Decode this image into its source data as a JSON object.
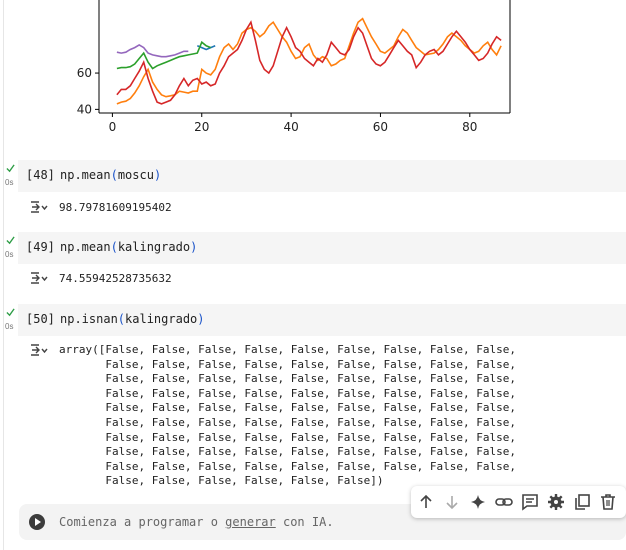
{
  "chart_data": {
    "type": "line",
    "x_ticks": [
      "0",
      "20",
      "40",
      "60",
      "80"
    ],
    "y_ticks": [
      "40",
      "60"
    ],
    "xlim": [
      -3,
      89
    ],
    "ylim": [
      38,
      103
    ],
    "colors": {
      "blue": "#1f77b4",
      "orange": "#ff7f0e",
      "green": "#2ca02c",
      "red": "#d62728",
      "purple": "#9467bd"
    },
    "series": [
      {
        "color": "purple",
        "values": [
          [
            1,
            71.5
          ],
          [
            2,
            71
          ],
          [
            3,
            71.5
          ],
          [
            4,
            73
          ],
          [
            5,
            74
          ],
          [
            6,
            75.5
          ],
          [
            7,
            74
          ],
          [
            8,
            71
          ],
          [
            9,
            70
          ],
          [
            10,
            69.5
          ],
          [
            11,
            69
          ],
          [
            12,
            69
          ],
          [
            13,
            69.5
          ],
          [
            14,
            70
          ],
          [
            15,
            71
          ],
          [
            16,
            72
          ],
          [
            17,
            72
          ]
        ]
      },
      {
        "color": "blue",
        "values": [
          [
            19,
            75
          ],
          [
            20,
            74
          ],
          [
            21,
            73
          ],
          [
            22,
            74
          ],
          [
            23,
            75
          ]
        ]
      },
      {
        "color": "green",
        "values": [
          [
            1,
            62.5
          ],
          [
            2,
            63
          ],
          [
            3,
            63
          ],
          [
            4,
            63.5
          ],
          [
            5,
            65
          ],
          [
            6,
            68
          ],
          [
            7,
            71
          ],
          [
            8,
            66
          ],
          [
            9,
            62.5
          ],
          [
            10,
            64
          ],
          [
            11,
            65
          ],
          [
            12,
            66
          ],
          [
            13,
            67
          ],
          [
            14,
            68
          ],
          [
            15,
            69
          ],
          [
            16,
            69.5
          ],
          [
            17,
            70
          ],
          [
            18,
            70.5
          ],
          [
            19,
            71
          ],
          [
            20,
            77
          ],
          [
            21,
            75
          ],
          [
            22,
            74
          ]
        ]
      },
      {
        "color": "orange",
        "values": [
          [
            1,
            43
          ],
          [
            2,
            44
          ],
          [
            3,
            44.5
          ],
          [
            4,
            46
          ],
          [
            5,
            49
          ],
          [
            6,
            53
          ],
          [
            7,
            58
          ],
          [
            8,
            62
          ],
          [
            9,
            55
          ],
          [
            10,
            51
          ],
          [
            11,
            48
          ],
          [
            12,
            47
          ],
          [
            13,
            47.5
          ],
          [
            14,
            48
          ],
          [
            15,
            50
          ],
          [
            16,
            49.5
          ],
          [
            17,
            49
          ],
          [
            18,
            50
          ],
          [
            19,
            50
          ],
          [
            20,
            62
          ],
          [
            21,
            60
          ],
          [
            22,
            59
          ],
          [
            23,
            62
          ],
          [
            24,
            69
          ],
          [
            25,
            74
          ],
          [
            26,
            76
          ],
          [
            27,
            73
          ],
          [
            28,
            76
          ],
          [
            29,
            82
          ],
          [
            30,
            84
          ],
          [
            31,
            85
          ],
          [
            32,
            83
          ],
          [
            33,
            80
          ],
          [
            34,
            82
          ],
          [
            35,
            86
          ],
          [
            36,
            88
          ],
          [
            37,
            84
          ],
          [
            38,
            80
          ],
          [
            39,
            77
          ],
          [
            40,
            72
          ],
          [
            41,
            68
          ],
          [
            42,
            69
          ],
          [
            43,
            74
          ],
          [
            44,
            76
          ],
          [
            45,
            70
          ],
          [
            46,
            67
          ],
          [
            47,
            69
          ],
          [
            48,
            68
          ],
          [
            49,
            64
          ],
          [
            50,
            65
          ],
          [
            51,
            67
          ],
          [
            52,
            68
          ],
          [
            53,
            75
          ],
          [
            54,
            82
          ],
          [
            55,
            88
          ],
          [
            56,
            90
          ],
          [
            57,
            85
          ],
          [
            58,
            80
          ],
          [
            59,
            76
          ],
          [
            60,
            72
          ],
          [
            61,
            71
          ],
          [
            62,
            73
          ],
          [
            63,
            75
          ],
          [
            64,
            80
          ],
          [
            65,
            84
          ],
          [
            66,
            82
          ],
          [
            67,
            78
          ],
          [
            68,
            74
          ],
          [
            69,
            72
          ],
          [
            70,
            70
          ],
          [
            71,
            70.5
          ],
          [
            72,
            71
          ],
          [
            73,
            73
          ],
          [
            74,
            76
          ],
          [
            75,
            80
          ],
          [
            76,
            82
          ],
          [
            77,
            80
          ],
          [
            78,
            78
          ],
          [
            79,
            75
          ],
          [
            80,
            73
          ],
          [
            81,
            71
          ],
          [
            82,
            72
          ],
          [
            83,
            75
          ],
          [
            84,
            77
          ],
          [
            85,
            73
          ],
          [
            86,
            70
          ],
          [
            87,
            75
          ]
        ]
      },
      {
        "color": "red",
        "values": [
          [
            1,
            48
          ],
          [
            2,
            51
          ],
          [
            3,
            51
          ],
          [
            4,
            53
          ],
          [
            5,
            57
          ],
          [
            6,
            61
          ],
          [
            7,
            66
          ],
          [
            8,
            57
          ],
          [
            9,
            50
          ],
          [
            10,
            44
          ],
          [
            11,
            43
          ],
          [
            12,
            44
          ],
          [
            13,
            45
          ],
          [
            14,
            48
          ],
          [
            15,
            53
          ],
          [
            16,
            57
          ],
          [
            17,
            53
          ],
          [
            18,
            56
          ],
          [
            19,
            57
          ],
          [
            20,
            54
          ],
          [
            21,
            55
          ],
          [
            22,
            53
          ],
          [
            23,
            54
          ],
          [
            24,
            60
          ],
          [
            25,
            64
          ],
          [
            26,
            69
          ],
          [
            27,
            71
          ],
          [
            28,
            73
          ],
          [
            29,
            78
          ],
          [
            30,
            84
          ],
          [
            31,
            88
          ],
          [
            32,
            78
          ],
          [
            33,
            67
          ],
          [
            34,
            62
          ],
          [
            35,
            60
          ],
          [
            36,
            64
          ],
          [
            37,
            72
          ],
          [
            38,
            80
          ],
          [
            39,
            85
          ],
          [
            40,
            80
          ],
          [
            41,
            74
          ],
          [
            42,
            72
          ],
          [
            43,
            68
          ],
          [
            44,
            66
          ],
          [
            45,
            64
          ],
          [
            46,
            68
          ],
          [
            47,
            66
          ],
          [
            48,
            70
          ],
          [
            49,
            77
          ],
          [
            50,
            74
          ],
          [
            51,
            71
          ],
          [
            52,
            70
          ],
          [
            53,
            73
          ],
          [
            54,
            80
          ],
          [
            55,
            85
          ],
          [
            56,
            82
          ],
          [
            57,
            75
          ],
          [
            58,
            68
          ],
          [
            59,
            65
          ],
          [
            60,
            64
          ],
          [
            61,
            66
          ],
          [
            62,
            70
          ],
          [
            63,
            74
          ],
          [
            64,
            78
          ],
          [
            65,
            75
          ],
          [
            66,
            72
          ],
          [
            67,
            70
          ],
          [
            68,
            63
          ],
          [
            69,
            66
          ],
          [
            70,
            70
          ],
          [
            71,
            72
          ],
          [
            72,
            73
          ],
          [
            73,
            70
          ],
          [
            74,
            72
          ],
          [
            75,
            76
          ],
          [
            76,
            80
          ],
          [
            77,
            83
          ],
          [
            78,
            80
          ],
          [
            79,
            77
          ],
          [
            80,
            73
          ],
          [
            81,
            70
          ],
          [
            82,
            67
          ],
          [
            83,
            68
          ],
          [
            84,
            71
          ],
          [
            85,
            76
          ],
          [
            86,
            80
          ],
          [
            87,
            78
          ]
        ]
      }
    ]
  },
  "cells": [
    {
      "count": "[48]",
      "time": "0s",
      "fn": "np.mean",
      "open": "(",
      "arg": "moscu",
      "close": ")",
      "output": "98.79781609195402"
    },
    {
      "count": "[49]",
      "time": "0s",
      "fn": "np.mean",
      "open": "(",
      "arg": "kalingrado",
      "close": ")",
      "output": "74.55942528735632"
    },
    {
      "count": "[50]",
      "time": "0s",
      "fn": "np.isnan",
      "open": "(",
      "arg": "kalingrado",
      "close": ")",
      "output": "array([False, False, False, False, False, False, False, False, False,\n       False, False, False, False, False, False, False, False, False,\n       False, False, False, False, False, False, False, False, False,\n       False, False, False, False, False, False, False, False, False,\n       False, False, False, False, False, False, False, False, False,\n       False, False, False, False, False, False, False, False, False,\n       False, False, False, False, False, False, False, False, False,\n       False, False, False, False, False, False, False, False, False,\n       False, False, False, False, False, False, False, False, False,\n       False, False, False, False, False, False])"
    }
  ],
  "toolbar": {
    "icons": [
      "arrow-up-icon",
      "arrow-down-icon",
      "sparkle-icon",
      "link-icon",
      "comment-icon",
      "gear-icon",
      "mirror-cell-icon",
      "trash-icon"
    ]
  },
  "prompt": {
    "before": "Comienza a programar o ",
    "link": "generar",
    "after": " con IA."
  }
}
